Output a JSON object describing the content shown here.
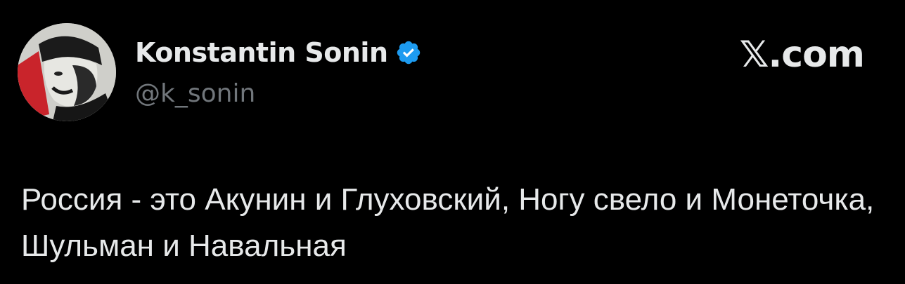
{
  "author": {
    "display_name": "Konstantin Sonin",
    "handle": "@k_sonin",
    "verified_icon": "verified-badge-icon",
    "avatar_icon": "avatar"
  },
  "brand": {
    "label": "𝕏.com"
  },
  "tweet": {
    "text": "Россия - это Акунин и Глуховский, Ногу свело и Монеточка, Шульман и Навальная"
  },
  "colors": {
    "background": "#000000",
    "text": "#e7e9ea",
    "secondary_text": "#71767b",
    "verified_blue": "#1d9bf0"
  }
}
